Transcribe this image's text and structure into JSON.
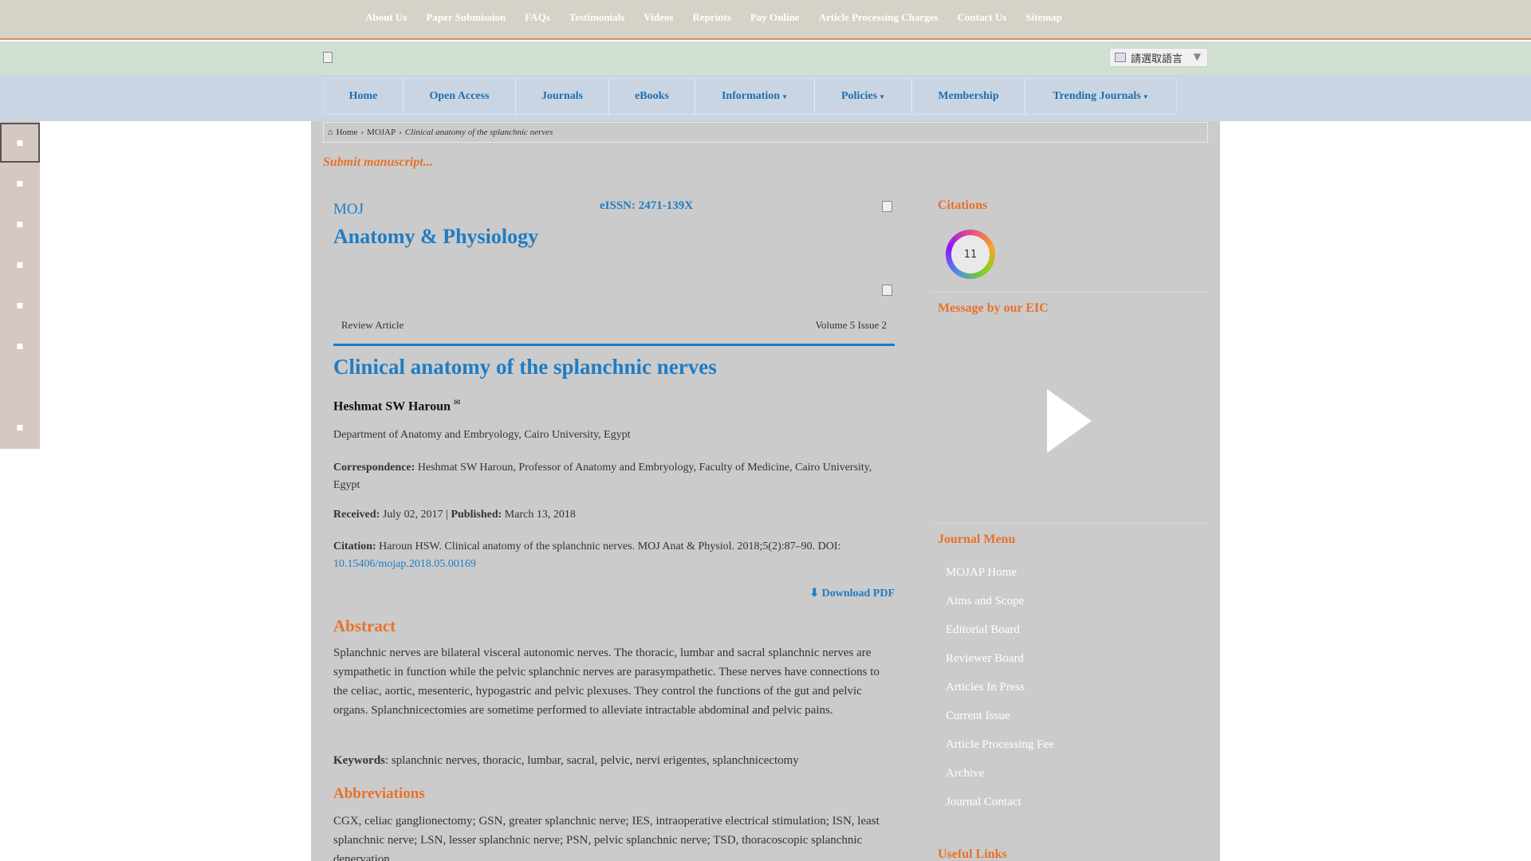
{
  "topnav": [
    "About Us",
    "Paper Submission",
    "FAQs",
    "Testimonials",
    "Videos",
    "Reprints",
    "Pay Online",
    "Article Processing Charges",
    "Contact Us",
    "Sitemap"
  ],
  "language": {
    "label": "請選取語言",
    "caret": "▼"
  },
  "mainmenu": [
    {
      "label": "Home",
      "dropdown": false
    },
    {
      "label": "Open Access",
      "dropdown": false
    },
    {
      "label": "Journals",
      "dropdown": false
    },
    {
      "label": "eBooks",
      "dropdown": false
    },
    {
      "label": "Information",
      "dropdown": true
    },
    {
      "label": "Policies",
      "dropdown": true
    },
    {
      "label": "Membership",
      "dropdown": false
    },
    {
      "label": "Trending Journals",
      "dropdown": true
    }
  ],
  "breadcrumb": {
    "home": "Home",
    "journal": "MOJAP",
    "current": "Clinical anatomy of the splanchnic nerves"
  },
  "submit_label": "Submit manuscript...",
  "journal": {
    "prefix": "MOJ",
    "name": "Anatomy & Physiology",
    "eissn": "eISSN: 2471-139X"
  },
  "article": {
    "type": "Review Article",
    "volume": "Volume 5 Issue 2",
    "title": "Clinical anatomy of the splanchnic nerves",
    "author": "Heshmat SW Haroun",
    "affiliation": "Department of Anatomy and Embryology, Cairo University, Egypt",
    "correspondence_label": "Correspondence:",
    "correspondence": "Heshmat SW Haroun, Professor of Anatomy and Embryology, Faculty of Medicine, Cairo University, Egypt",
    "received_label": "Received:",
    "received": "July 02, 2017",
    "published_label": "Published:",
    "published": "March 13, 2018",
    "citation_label": "Citation:",
    "citation": "Haroun HSW. Clinical anatomy of the splanchnic nerves. MOJ Anat & Physiol. 2018;5(2):87–90. DOI:",
    "doi": "10.15406/mojap.2018.05.00169",
    "download": "Download PDF",
    "abstract_heading": "Abstract",
    "abstract": "Splanchnic nerves are bilateral visceral autonomic nerves. The thoracic, lumbar and sacral splanchnic nerves are sympathetic in function while the pelvic splanchnic nerves are parasympathetic. These nerves have connections to the celiac, aortic, mesenteric, hypogastric and pelvic plexuses. They control the functions of the gut and pelvic organs. Splanchnicectomies are sometime performed to alleviate intractable abdominal and pelvic pains.",
    "keywords_label": "Keywords",
    "keywords": ": splanchnic nerves, thoracic, lumbar, sacral, pelvic, nervi erigentes, splanchnicectomy",
    "abbrev_heading": "Abbreviations",
    "abbreviations": "CGX, celiac ganglionectomy; GSN, greater splanchnic nerve; IES, intraoperative electrical stimulation; ISN, least splanchnic nerve; LSN, lesser splanchnic nerve; PSN, pelvic splanchnic nerve; TSD, thoracoscopic splanchnic denervation"
  },
  "sidebar": {
    "citations_heading": "Citations",
    "citations_count": "11",
    "eic_heading": "Message by our EIC",
    "menu_heading": "Journal Menu",
    "menu": [
      "MOJAP Home",
      "Aims and Scope",
      "Editorial Board",
      "Reviewer Board",
      "Articles In Press",
      "Current Issue",
      "Article Processing Fee",
      "Archive",
      "Journal Contact"
    ],
    "useful_heading": "Useful Links"
  }
}
